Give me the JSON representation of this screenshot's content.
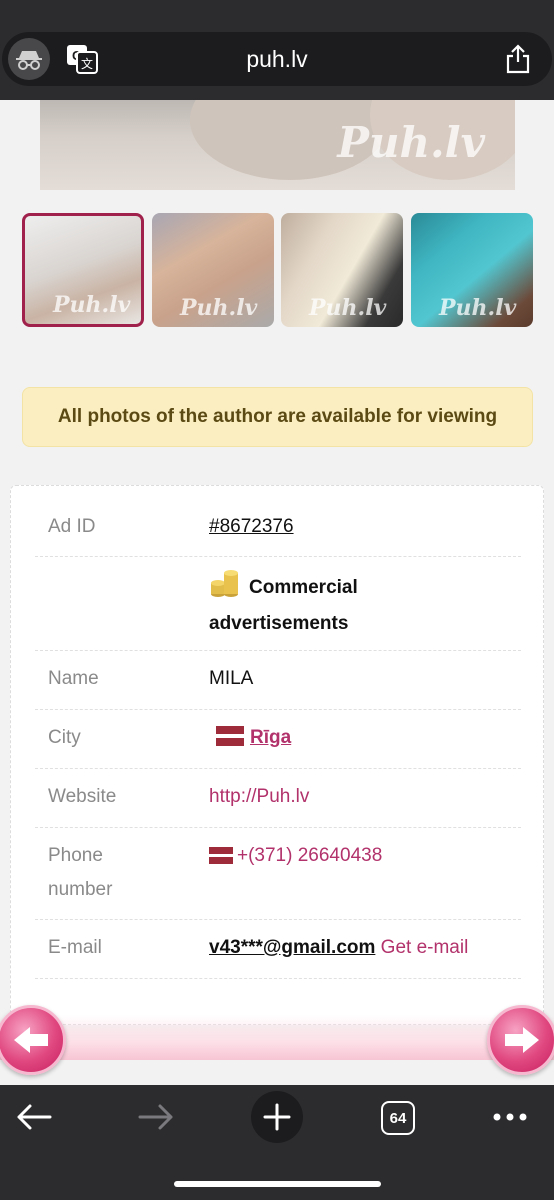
{
  "browser": {
    "url": "puh.lv",
    "tab_count": "64"
  },
  "gallery": {
    "watermark": "Puh.lv",
    "thumbnail_count": 4,
    "selected_index": 0
  },
  "notice": {
    "text": "All photos of the author are available for viewing"
  },
  "details": {
    "ad_id_label": "Ad ID",
    "ad_id_value": "#8672376",
    "category": "Commercial advertisements",
    "name_label": "Name",
    "name_value": "MILA",
    "city_label": "City",
    "city_value": "Rīga",
    "website_label": "Website",
    "website_value": "http://Puh.lv",
    "phone_label": "Phone number",
    "phone_value": "+(371) 26640438",
    "email_label": "E-mail",
    "email_value": "v43***@gmail.com",
    "get_email": "Get e-mail"
  },
  "colors": {
    "accent": "#b2326b",
    "notice_bg": "#fbefc2",
    "arrow": "#e0477f"
  }
}
